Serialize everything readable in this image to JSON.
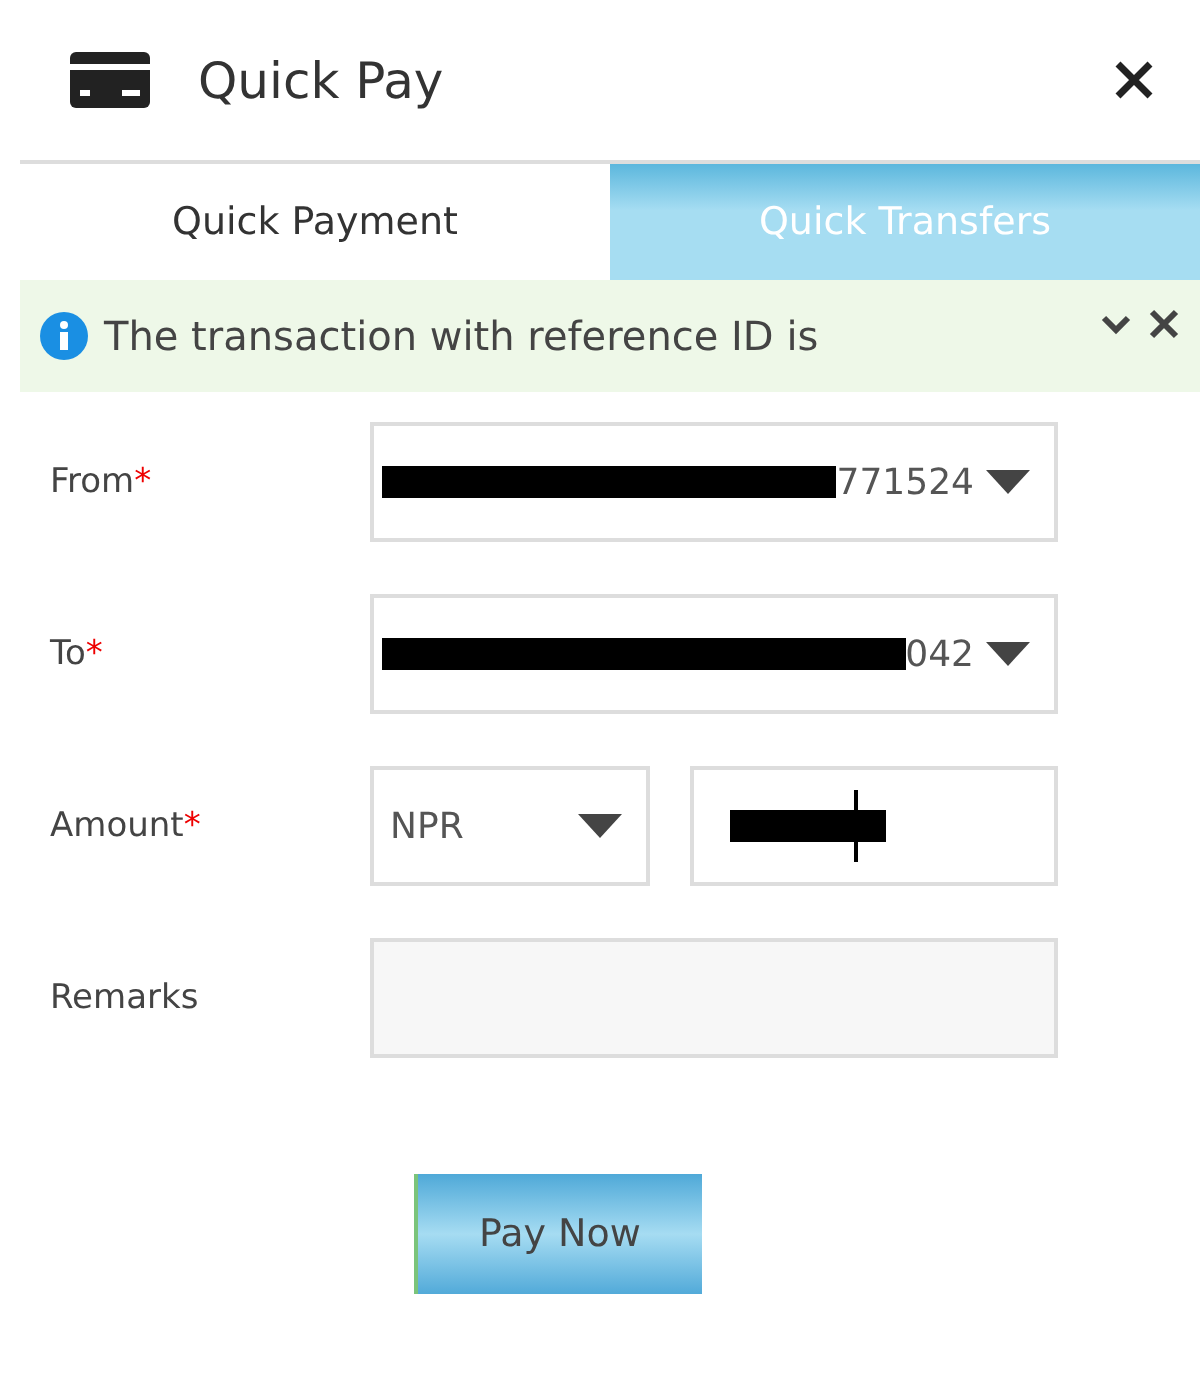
{
  "window": {
    "title": "Quick Pay"
  },
  "tabs": [
    {
      "label": "Quick Payment",
      "selected": true
    },
    {
      "label": "Quick Transfers",
      "selected": false
    }
  ],
  "alert": {
    "message": "The transaction with reference ID is"
  },
  "fields": [
    {
      "label": "From",
      "required_mark": "*",
      "kind": "select",
      "value": "771524",
      "redacted": true
    },
    {
      "label": "To",
      "required_mark": "*",
      "kind": "select",
      "value": "042",
      "redacted": true
    },
    {
      "label": "Amount",
      "required_mark": "*",
      "kind": "amount",
      "currency": "NPR",
      "redacted": true
    },
    {
      "label": "Remarks",
      "kind": "text"
    }
  ],
  "submit": {
    "label": "Pay Now"
  }
}
